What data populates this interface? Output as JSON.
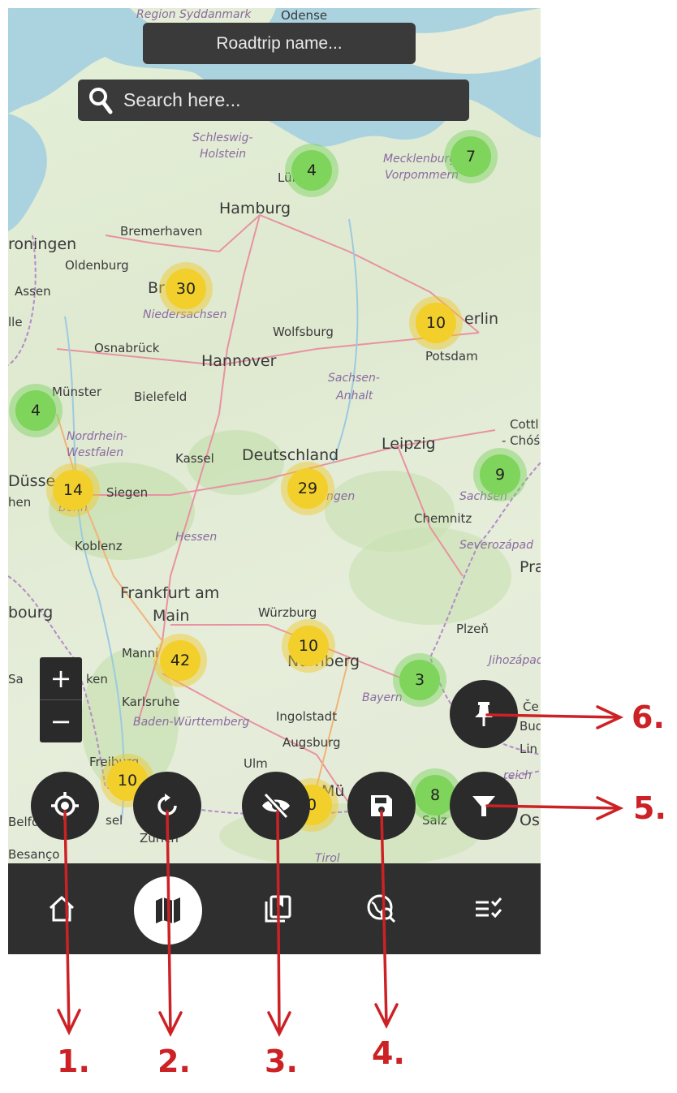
{
  "header": {
    "trip_name_placeholder": "Roadtrip name...",
    "search_placeholder": "Search here..."
  },
  "map": {
    "places": [
      {
        "id": "region-syddanmark",
        "text": "Region Syddanmark"
      },
      {
        "id": "odense",
        "text": "Odense"
      },
      {
        "id": "schleswig",
        "text": "Schleswig-"
      },
      {
        "id": "holstein",
        "text": "Holstein"
      },
      {
        "id": "lubeck",
        "text": "Lübeck"
      },
      {
        "id": "mecklenburg",
        "text": "Mecklenburg-"
      },
      {
        "id": "vorpommern",
        "text": "Vorpommern"
      },
      {
        "id": "hamburg",
        "text": "Hamburg"
      },
      {
        "id": "bremerhaven",
        "text": "Bremerhaven"
      },
      {
        "id": "groningen",
        "text": "roningen"
      },
      {
        "id": "oldenburg",
        "text": "Oldenburg"
      },
      {
        "id": "bremen",
        "text": "Br"
      },
      {
        "id": "assen",
        "text": "Assen"
      },
      {
        "id": "niedersachsen",
        "text": "Niedersachsen"
      },
      {
        "id": "berlin",
        "text": "erlin"
      },
      {
        "id": "potsdam",
        "text": "Potsdam"
      },
      {
        "id": "wolfsburg",
        "text": "Wolfsburg"
      },
      {
        "id": "lle",
        "text": "lle"
      },
      {
        "id": "osnabruck",
        "text": "Osnabrück"
      },
      {
        "id": "hannover",
        "text": "Hannover"
      },
      {
        "id": "sachsen-anhalt1",
        "text": "Sachsen-"
      },
      {
        "id": "sachsen-anhalt2",
        "text": "Anhalt"
      },
      {
        "id": "munster",
        "text": "Münster"
      },
      {
        "id": "bielefeld",
        "text": "Bielefeld"
      },
      {
        "id": "nrw1",
        "text": "Nordrhein-"
      },
      {
        "id": "nrw2",
        "text": "Westfalen"
      },
      {
        "id": "kassel",
        "text": "Kassel"
      },
      {
        "id": "deutschland",
        "text": "Deutschland"
      },
      {
        "id": "leipzig",
        "text": "Leipzig"
      },
      {
        "id": "cottbus",
        "text": "Cottl"
      },
      {
        "id": "chos",
        "text": "- Chóś"
      },
      {
        "id": "dusseldorf",
        "text": "Düsse"
      },
      {
        "id": "siegen",
        "text": "Siegen"
      },
      {
        "id": "thuringen",
        "text": "Thüringen"
      },
      {
        "id": "sachsen",
        "text": "Sachsen"
      },
      {
        "id": "chemnitz",
        "text": "Chemnitz"
      },
      {
        "id": "eln",
        "text": "hen"
      },
      {
        "id": "bonn",
        "text": "Bonn"
      },
      {
        "id": "hessen",
        "text": "Hessen"
      },
      {
        "id": "severozapad",
        "text": "Severozápad"
      },
      {
        "id": "koblenz",
        "text": "Koblenz"
      },
      {
        "id": "prague",
        "text": "Pra"
      },
      {
        "id": "frankfurt1",
        "text": "Frankfurt am"
      },
      {
        "id": "frankfurt2",
        "text": "Main"
      },
      {
        "id": "luxemburg",
        "text": "bourg"
      },
      {
        "id": "wurzburg",
        "text": "Würzburg"
      },
      {
        "id": "plzen",
        "text": "Plzeň"
      },
      {
        "id": "mannheim",
        "text": "Manni"
      },
      {
        "id": "nurnberg",
        "text": "Nürnberg"
      },
      {
        "id": "jihozapad",
        "text": "Jihozápad"
      },
      {
        "id": "saarbrucken1",
        "text": "Sa"
      },
      {
        "id": "saarbrucken2",
        "text": "ken"
      },
      {
        "id": "karlsruhe",
        "text": "Karlsruhe"
      },
      {
        "id": "bayern",
        "text": "Bayern"
      },
      {
        "id": "baden-wurttemberg",
        "text": "Baden-Württemberg"
      },
      {
        "id": "ingolstadt",
        "text": "Ingolstadt"
      },
      {
        "id": "augsburg",
        "text": "Augsburg"
      },
      {
        "id": "ulm",
        "text": "Ulm"
      },
      {
        "id": "freiburg",
        "text": "Freiburg"
      },
      {
        "id": "linz",
        "text": "Lin"
      },
      {
        "id": "basel",
        "text": "sel"
      },
      {
        "id": "zurich",
        "text": "Zürich"
      },
      {
        "id": "belfort",
        "text": "Belfo"
      },
      {
        "id": "munchen",
        "text": "Mü"
      },
      {
        "id": "salzburg",
        "text": "Salz"
      },
      {
        "id": "tirol",
        "text": "Tirol"
      },
      {
        "id": "besancon",
        "text": "Besanço"
      },
      {
        "id": "reich",
        "text": "reich"
      },
      {
        "id": "os",
        "text": "Os"
      },
      {
        "id": "budweis",
        "text": "Budě"
      },
      {
        "id": "ce",
        "text": "Če"
      }
    ],
    "clusters": [
      {
        "count": "4",
        "color": "green"
      },
      {
        "count": "7",
        "color": "green"
      },
      {
        "count": "30",
        "color": "yellow"
      },
      {
        "count": "10",
        "color": "yellow"
      },
      {
        "count": "4",
        "color": "green"
      },
      {
        "count": "9",
        "color": "green"
      },
      {
        "count": "14",
        "color": "yellow"
      },
      {
        "count": "29",
        "color": "yellow"
      },
      {
        "count": "10",
        "color": "yellow"
      },
      {
        "count": "42",
        "color": "yellow"
      },
      {
        "count": "3",
        "color": "green"
      },
      {
        "count": "10",
        "color": "yellow"
      },
      {
        "count": "0",
        "color": "yellow"
      },
      {
        "count": "8",
        "color": "green"
      }
    ],
    "zoom_in_label": "+",
    "zoom_out_label": "−"
  },
  "actions": [
    {
      "name": "locate-button",
      "icon": "crosshair-icon"
    },
    {
      "name": "reset-button",
      "icon": "rotate-icon"
    },
    {
      "name": "hide-button",
      "icon": "eye-off-icon"
    },
    {
      "name": "save-button",
      "icon": "floppy-icon"
    },
    {
      "name": "filter-button",
      "icon": "filter-icon"
    },
    {
      "name": "pin-button",
      "icon": "pushpin-icon"
    }
  ],
  "nav": {
    "items": [
      {
        "name": "home",
        "icon": "home-icon"
      },
      {
        "name": "map",
        "icon": "map-icon",
        "active": true
      },
      {
        "name": "saved",
        "icon": "bookmarks-icon"
      },
      {
        "name": "explore",
        "icon": "globe-search-icon"
      },
      {
        "name": "checklist",
        "icon": "checklist-icon"
      }
    ]
  },
  "annotations": {
    "labels": [
      "1.",
      "2.",
      "3.",
      "4.",
      "5.",
      "6."
    ],
    "color": "#cc2226"
  },
  "colors": {
    "panel": "#3a3a3a",
    "fab": "#2b2b2b",
    "navbar": "#2f2f2f",
    "cluster_yellow": "#f2cf2a",
    "cluster_green": "#7fd45c"
  }
}
